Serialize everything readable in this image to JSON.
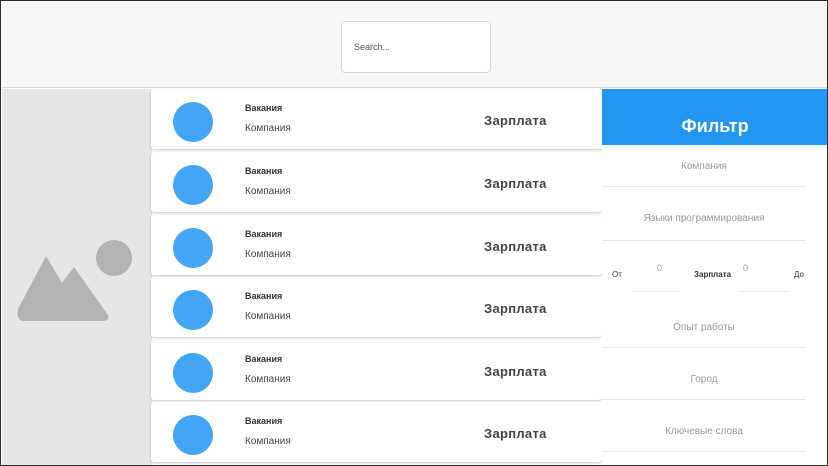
{
  "search": {
    "placeholder": "Search..."
  },
  "image_placeholder_icon": "image-placeholder-icon",
  "vacancies": [
    {
      "title": "Вакания",
      "company": "Компания",
      "salary": "Зарплата"
    },
    {
      "title": "Вакания",
      "company": "Компания",
      "salary": "Зарплата"
    },
    {
      "title": "Вакания",
      "company": "Компания",
      "salary": "Зарплата"
    },
    {
      "title": "Вакания",
      "company": "Компания",
      "salary": "Зарплата"
    },
    {
      "title": "Вакания",
      "company": "Компания",
      "salary": "Зарплата"
    },
    {
      "title": "Вакания",
      "company": "Компания",
      "salary": "Зарплата"
    }
  ],
  "filter": {
    "title": "Фильтр",
    "company": "Компания",
    "languages": "Языки программирования",
    "salary_from_label": "От",
    "salary_from_value": "0",
    "salary_label": "Зарплата",
    "salary_to_value": "0",
    "salary_to_label": "До",
    "experience": "Опыт работы",
    "city": "Город",
    "keywords": "Ключевые слова"
  },
  "colors": {
    "accent": "#2196f3",
    "avatar": "#42a5f5",
    "sidebar_bg": "#e6e6e6",
    "header_bg": "#f7f7f7"
  }
}
